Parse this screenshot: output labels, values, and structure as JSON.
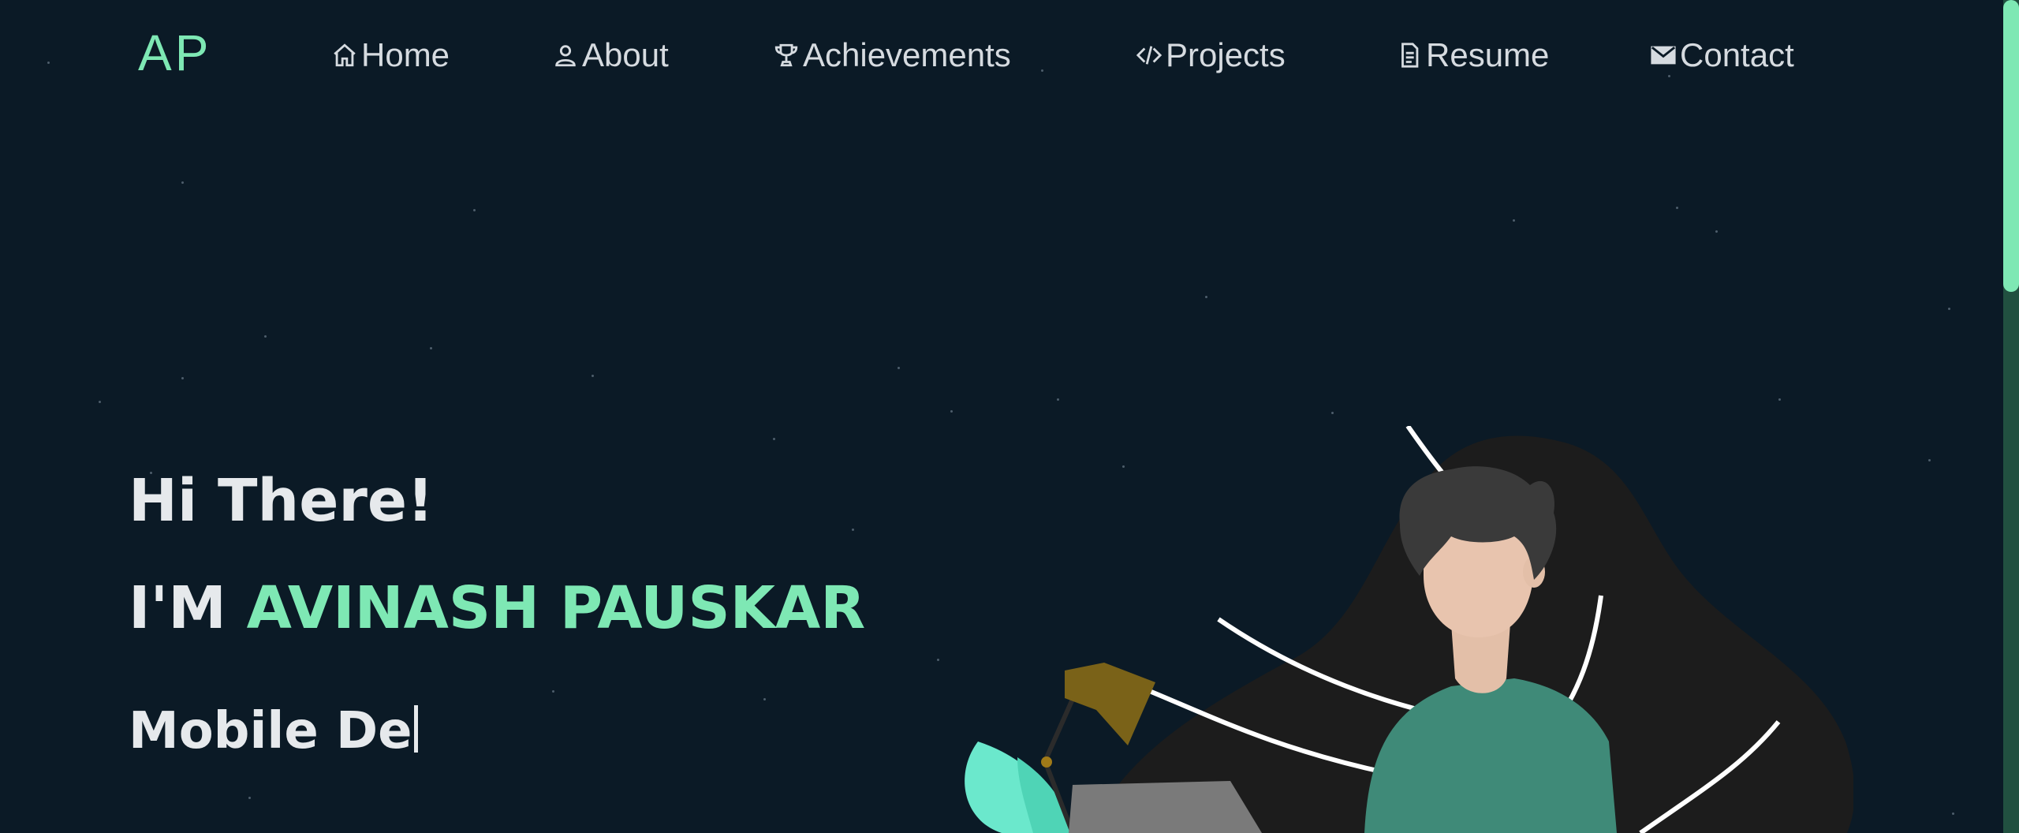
{
  "logo": "AP",
  "nav": {
    "items": [
      {
        "label": "Home",
        "icon": "home-icon"
      },
      {
        "label": "About",
        "icon": "user-icon"
      },
      {
        "label": "Achievements",
        "icon": "trophy-icon"
      },
      {
        "label": "Projects",
        "icon": "code-icon"
      },
      {
        "label": "Resume",
        "icon": "document-icon"
      },
      {
        "label": "Contact",
        "icon": "mail-icon"
      }
    ]
  },
  "hero": {
    "greeting": "Hi There!",
    "name_prefix": "I'M",
    "name": "AVINASH PAUSKAR",
    "typing_text": "Mobile De"
  },
  "colors": {
    "background": "#0b1a26",
    "accent": "#7ee8b4",
    "text": "#e6e9ec"
  }
}
